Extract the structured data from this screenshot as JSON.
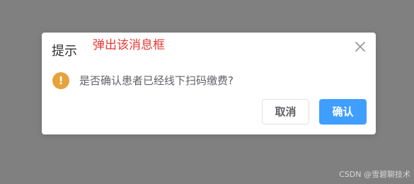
{
  "dialog": {
    "title": "提示",
    "annotation": "弹出该消息框",
    "message": "是否确认患者已经线下扫码缴费?",
    "warning_icon_glyph": "!",
    "icons": {
      "warning": "warning-icon",
      "close": "close-icon"
    },
    "buttons": {
      "cancel_label": "取消",
      "confirm_label": "确认"
    }
  },
  "watermark": "CSDN @雪碧聊技术",
  "colors": {
    "overlay": "#808080",
    "dialog_bg": "#ffffff",
    "title_text": "#303133",
    "annotation_text": "#e53935",
    "warning": "#e6a23c",
    "message_text": "#606266",
    "primary": "#409eff",
    "border": "#dcdfe6",
    "close_icon": "#909399"
  }
}
